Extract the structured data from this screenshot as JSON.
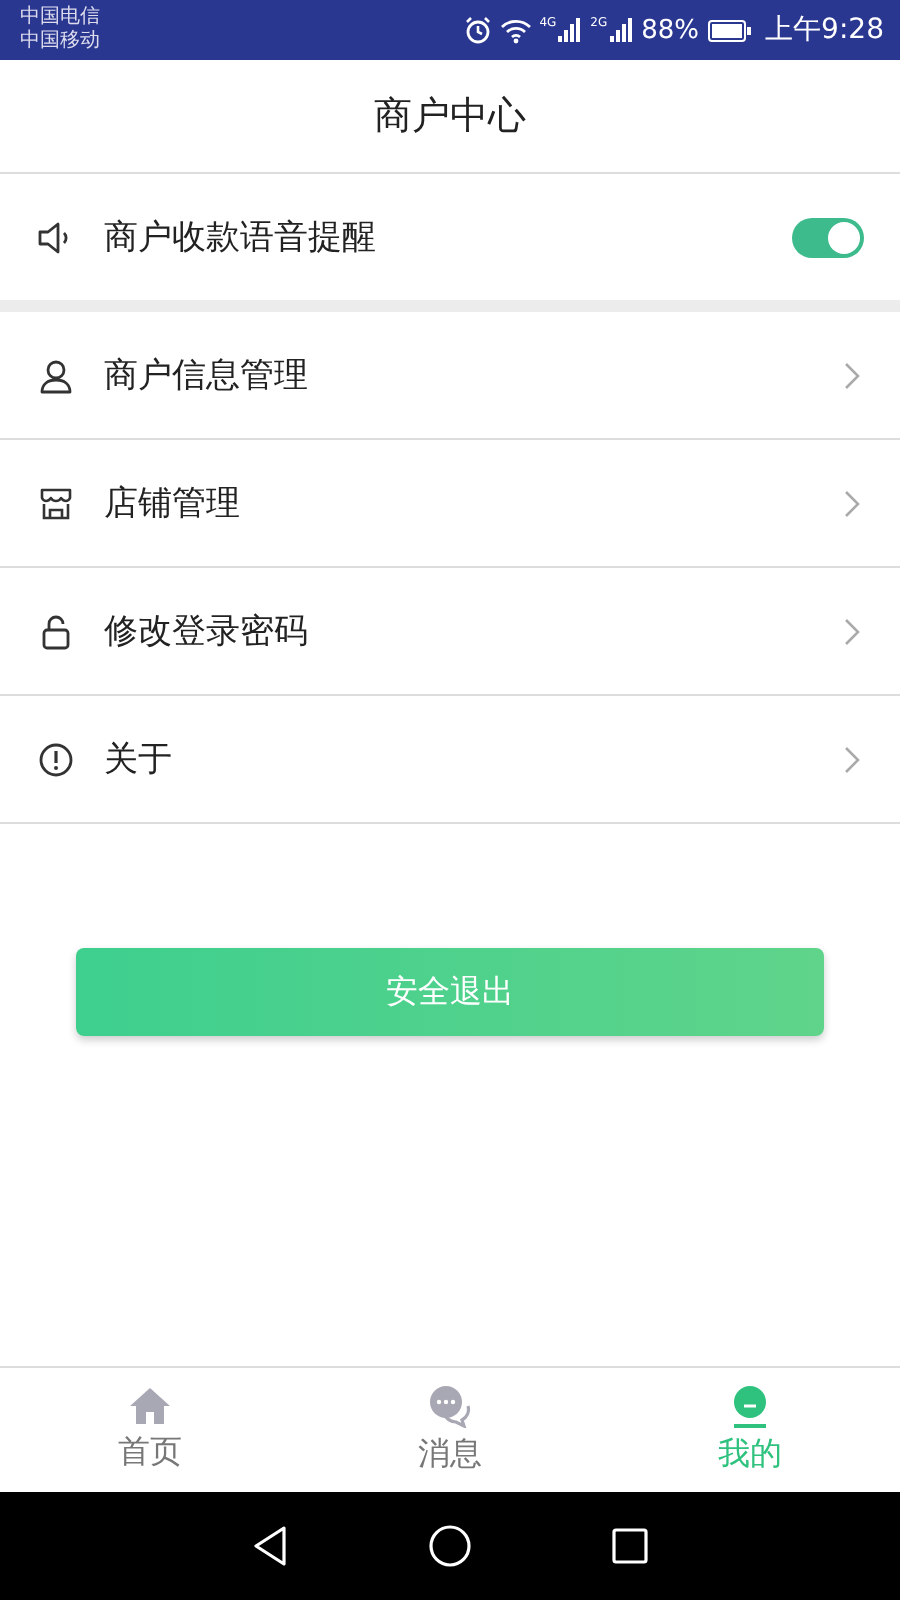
{
  "status_bar": {
    "carriers": [
      "中国电信",
      "中国移动"
    ],
    "networks": [
      "4G",
      "2G"
    ],
    "battery": "88%",
    "time": "上午9:28"
  },
  "header": {
    "title": "商户中心"
  },
  "voice_alert": {
    "label": "商户收款语音提醒",
    "on": true
  },
  "menu": [
    {
      "label": "商户信息管理"
    },
    {
      "label": "店铺管理"
    },
    {
      "label": "修改登录密码"
    },
    {
      "label": "关于"
    }
  ],
  "logout_button": "安全退出",
  "tabs": [
    {
      "label": "首页",
      "selected": false
    },
    {
      "label": "消息",
      "selected": false
    },
    {
      "label": "我的",
      "selected": true
    }
  ]
}
